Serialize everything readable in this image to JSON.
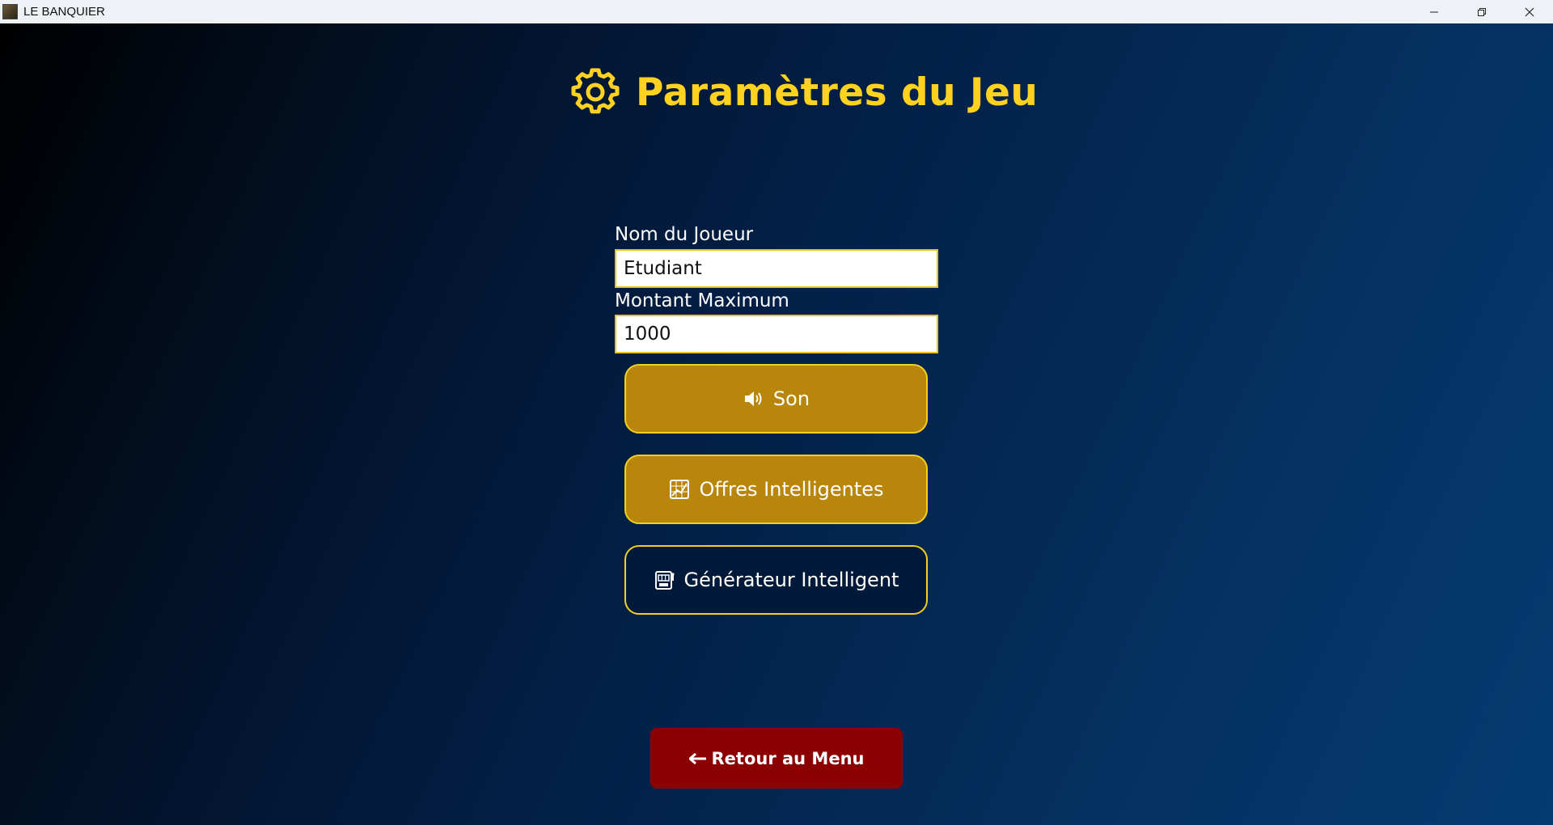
{
  "window": {
    "title": "LE BANQUIER",
    "controls": {
      "minimize": "—",
      "restore": "❐",
      "close": "✕"
    }
  },
  "page": {
    "title": "Paramètres du Jeu",
    "title_icon": "gear-icon",
    "accent_color": "#ffd21f"
  },
  "form": {
    "player_name": {
      "label": "Nom du Joueur",
      "value": "Etudiant"
    },
    "max_amount": {
      "label": "Montant Maximum",
      "value": "1000"
    }
  },
  "toggles": [
    {
      "label": "Son",
      "icon": "speaker-icon",
      "active": true
    },
    {
      "label": "Offres Intelligentes",
      "icon": "chart-icon",
      "active": true
    },
    {
      "label": "Générateur Intelligent",
      "icon": "slot-machine-icon",
      "active": false
    }
  ],
  "colors": {
    "toggle_on": "#b8860b",
    "toggle_off": "#021a3a",
    "toggle_border": "#f0d21c",
    "back_button": "#8b0000"
  },
  "back_button": {
    "label": "Retour au Menu",
    "icon": "arrow-left-icon"
  }
}
